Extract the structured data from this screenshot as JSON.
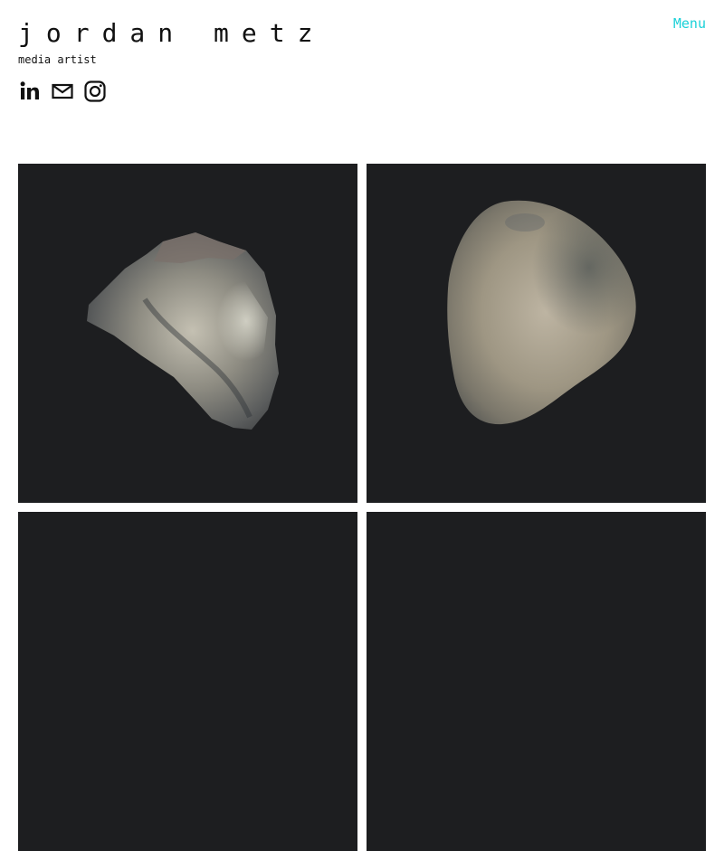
{
  "header": {
    "title": "jordan metz",
    "subtitle": "media artist"
  },
  "nav": {
    "menu_label": "Menu",
    "accent_color": "#1ad1d8"
  },
  "social": {
    "items": [
      {
        "icon": "linkedin-icon"
      },
      {
        "icon": "mail-icon"
      },
      {
        "icon": "instagram-icon"
      }
    ]
  },
  "gallery": {
    "background_color": "#1d1e20",
    "items": [
      {
        "subject": "rock-sculpture"
      },
      {
        "subject": "rounded-stone"
      },
      {
        "subject": ""
      },
      {
        "subject": ""
      }
    ]
  }
}
